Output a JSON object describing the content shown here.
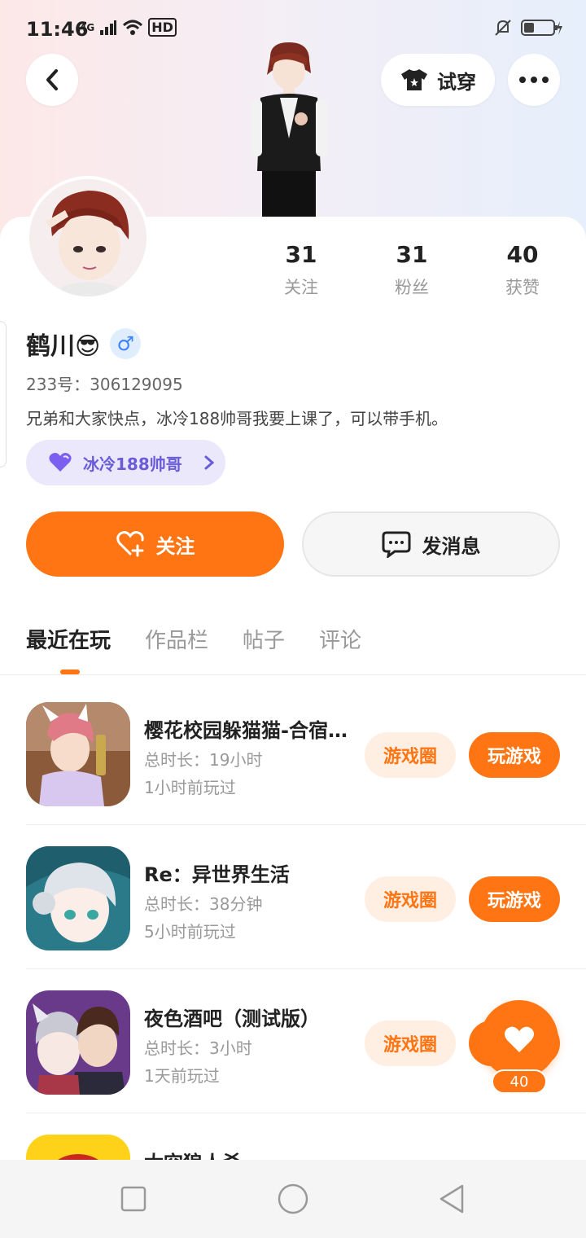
{
  "status_bar": {
    "time": "11:46",
    "network": "4G",
    "hd": "HD"
  },
  "header": {
    "tryon_label": "试穿"
  },
  "profile": {
    "stats": [
      {
        "value": "31",
        "label": "关注"
      },
      {
        "value": "31",
        "label": "粉丝"
      },
      {
        "value": "40",
        "label": "获赞"
      }
    ],
    "name": "鹤川😎",
    "gender_symbol": "♂",
    "uid": "233号：306129095",
    "bio": "兄弟和大家快点，冰冷188帅哥我要上课了，可以带手机。",
    "tag": "冰冷188帅哥"
  },
  "actions": {
    "follow_label": "关注",
    "message_label": "发消息"
  },
  "tabs": [
    {
      "label": "最近在玩",
      "active": true
    },
    {
      "label": "作品栏",
      "active": false
    },
    {
      "label": "帖子",
      "active": false
    },
    {
      "label": "评论",
      "active": false
    }
  ],
  "games": [
    {
      "title": "樱花校园躲猫猫-合宿…",
      "duration": "总时长：19小时",
      "last_played": "1小时前玩过",
      "circle_label": "游戏圈",
      "play_label": "玩游戏"
    },
    {
      "title": "Re：异世界生活",
      "duration": "总时长：38分钟",
      "last_played": "5小时前玩过",
      "circle_label": "游戏圈",
      "play_label": "玩游戏"
    },
    {
      "title": "夜色酒吧（测试版）",
      "duration": "总时长：3小时",
      "last_played": "1天前玩过",
      "circle_label": "游戏圈",
      "play_label": "玩游戏"
    },
    {
      "title": "太空狼人杀",
      "duration": "",
      "last_played": "",
      "circle_label": "",
      "play_label": ""
    }
  ],
  "floating_like": {
    "count": "40"
  },
  "colors": {
    "accent": "#ff7513",
    "tag_purple": "#6a5cd8",
    "tag_bg": "#ebe8fb"
  },
  "icons": [
    "back-icon",
    "tshirt-icon",
    "more-icon",
    "heart-plus-icon",
    "chat-icon",
    "purple-heart-icon",
    "chevron-right-icon",
    "like-heart-icon",
    "mute-icon",
    "battery-icon",
    "wifi-icon",
    "signal-icon"
  ]
}
